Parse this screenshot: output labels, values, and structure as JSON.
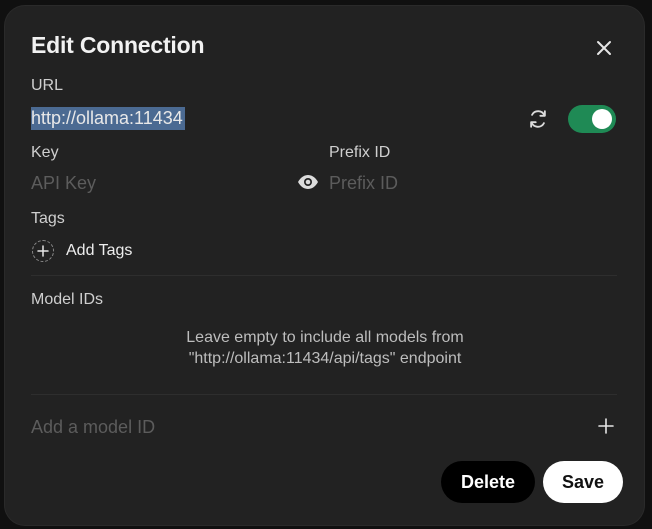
{
  "dialog": {
    "title": "Edit Connection",
    "close_icon": "close-icon"
  },
  "url": {
    "label": "URL",
    "value": "http://ollama:11434",
    "refresh_icon": "refresh-icon",
    "enabled": true,
    "toggle_color": "#1f8a55"
  },
  "key": {
    "label": "Key",
    "placeholder": "API Key",
    "visibility_icon": "eye-icon"
  },
  "prefix": {
    "label": "Prefix ID",
    "placeholder": "Prefix ID"
  },
  "tags": {
    "label": "Tags",
    "add_label": "Add Tags",
    "add_icon": "plus-icon"
  },
  "models": {
    "label": "Model IDs",
    "hint_line1": "Leave empty to include all models from",
    "hint_line2": "\"http://ollama:11434/api/tags\" endpoint",
    "add_placeholder": "Add a model ID",
    "add_icon": "plus-icon"
  },
  "actions": {
    "delete_label": "Delete",
    "save_label": "Save"
  }
}
